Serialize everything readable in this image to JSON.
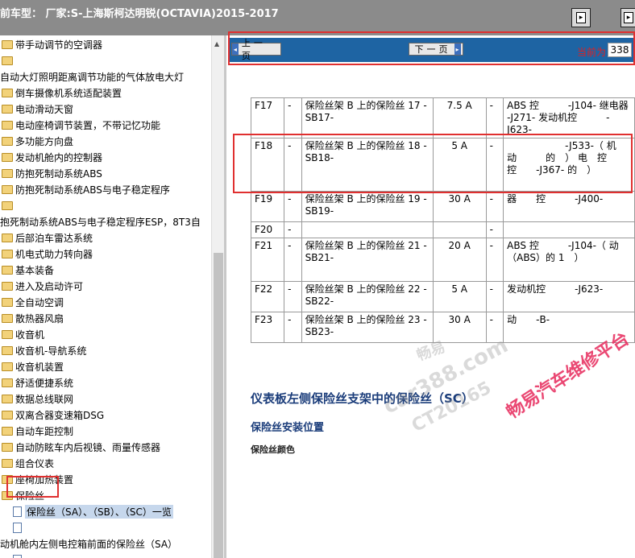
{
  "title": "前车型： 厂家:S-上海斯柯达明锐(OCTAVIA)2015-2017",
  "toolbar": {
    "btn1_icon": "page-forward-icon",
    "btn2_icon": "page-forward-icon"
  },
  "tree": {
    "items": [
      {
        "label": "带手动调节的空调器",
        "icon": "folder"
      },
      {
        "label": "",
        "icon": "folder"
      },
      {
        "label": "自动大灯照明距离调节功能的气体放电大灯",
        "icon": "none"
      },
      {
        "label": "倒车摄像机系统适配装置",
        "icon": "folder"
      },
      {
        "label": "电动滑动天窗",
        "icon": "folder"
      },
      {
        "label": "电动座椅调节装置，不带记忆功能",
        "icon": "folder"
      },
      {
        "label": "多功能方向盘",
        "icon": "folder"
      },
      {
        "label": "发动机舱内的控制器",
        "icon": "folder"
      },
      {
        "label": "防抱死制动系统ABS",
        "icon": "folder"
      },
      {
        "label": "防抱死制动系统ABS与电子稳定程序",
        "icon": "folder"
      },
      {
        "label": "",
        "icon": "folder"
      },
      {
        "label": "抱死制动系统ABS与电子稳定程序ESP，8T3自",
        "icon": "none"
      },
      {
        "label": "后部泊车雷达系统",
        "icon": "folder"
      },
      {
        "label": "机电式助力转向器",
        "icon": "folder"
      },
      {
        "label": "基本装备",
        "icon": "folder"
      },
      {
        "label": "进入及启动许可",
        "icon": "folder"
      },
      {
        "label": "全自动空调",
        "icon": "folder"
      },
      {
        "label": "散热器风扇",
        "icon": "folder"
      },
      {
        "label": "收音机",
        "icon": "folder"
      },
      {
        "label": "收音机-导航系统",
        "icon": "folder"
      },
      {
        "label": "收音机装置",
        "icon": "folder"
      },
      {
        "label": "舒适便捷系统",
        "icon": "folder"
      },
      {
        "label": "数据总线联网",
        "icon": "folder"
      },
      {
        "label": "双离合器变速箱DSG",
        "icon": "folder"
      },
      {
        "label": "自动车距控制",
        "icon": "folder"
      },
      {
        "label": "自动防眩车内后视镜、雨量传感器",
        "icon": "folder"
      },
      {
        "label": "组合仪表",
        "icon": "folder"
      },
      {
        "label": "座椅加热装置",
        "icon": "folder"
      },
      {
        "label": "保险丝",
        "icon": "folder-open"
      },
      {
        "label": "保险丝（SA）、（SB）、（SC）一览",
        "icon": "doc"
      },
      {
        "label": "",
        "icon": "doc"
      },
      {
        "label": "动机舱内左侧电控箱前面的保险丝（SA）",
        "icon": "none"
      },
      {
        "label": "",
        "icon": "doc"
      }
    ]
  },
  "nav": {
    "prev_label": "上一页",
    "next_label": "下一页",
    "page_label": "当前为",
    "page_value": "338"
  },
  "fuse_table": {
    "rows": [
      {
        "id": "F17",
        "dash1": "-",
        "desc": "保险丝架 B 上的保险丝 17 - SB17-",
        "amp": "7.5 A",
        "dash2": "-",
        "component": "ABS 控　　　-J104- 继电器 -J271- 发动机控　　　-J623-"
      },
      {
        "id": "F18",
        "dash1": "-",
        "desc": "保险丝架 B 上的保险丝 18 - SB18-",
        "amp": "5 A",
        "dash2": "-",
        "component": "　　　　　　-J533-（ 机　动　　　的　） 电　控控　　-J367- 的　）"
      },
      {
        "id": "F19",
        "dash1": "-",
        "desc": "保险丝架 B 上的保险丝 19 - SB19-",
        "amp": "30 A",
        "dash2": "-",
        "component": "器　　控　　　-J400-"
      },
      {
        "id": "F20",
        "dash1": "-",
        "desc": "",
        "amp": "",
        "dash2": "-",
        "component": ""
      },
      {
        "id": "F21",
        "dash1": "-",
        "desc": "保险丝架 B 上的保险丝 21 - SB21-",
        "amp": "20 A",
        "dash2": "-",
        "component": "ABS 控　　　-J104-（ 动　　（ABS）的 1　）"
      },
      {
        "id": "F22",
        "dash1": "-",
        "desc": "保险丝架 B 上的保险丝 22 - SB22-",
        "amp": "5 A",
        "dash2": "-",
        "component": "发动机控　　　-J623-"
      },
      {
        "id": "F23",
        "dash1": "-",
        "desc": "保险丝架 B 上的保险丝 23 - SB23-",
        "amp": "30 A",
        "dash2": "-",
        "component": "动　　-B-"
      }
    ]
  },
  "headings": {
    "h1": "仪表板左侧保险丝支架中的保险丝（SC）",
    "h2": "保险丝安装位置",
    "h3": "保险丝颜色"
  },
  "watermark": {
    "text1": "畅易",
    "text2": "car388.com",
    "text3": "CT20165",
    "text4": "畅易汽车维修平台"
  },
  "colors": {
    "accent_nav": "#1e64a3",
    "highlight_red": "#e03030"
  }
}
